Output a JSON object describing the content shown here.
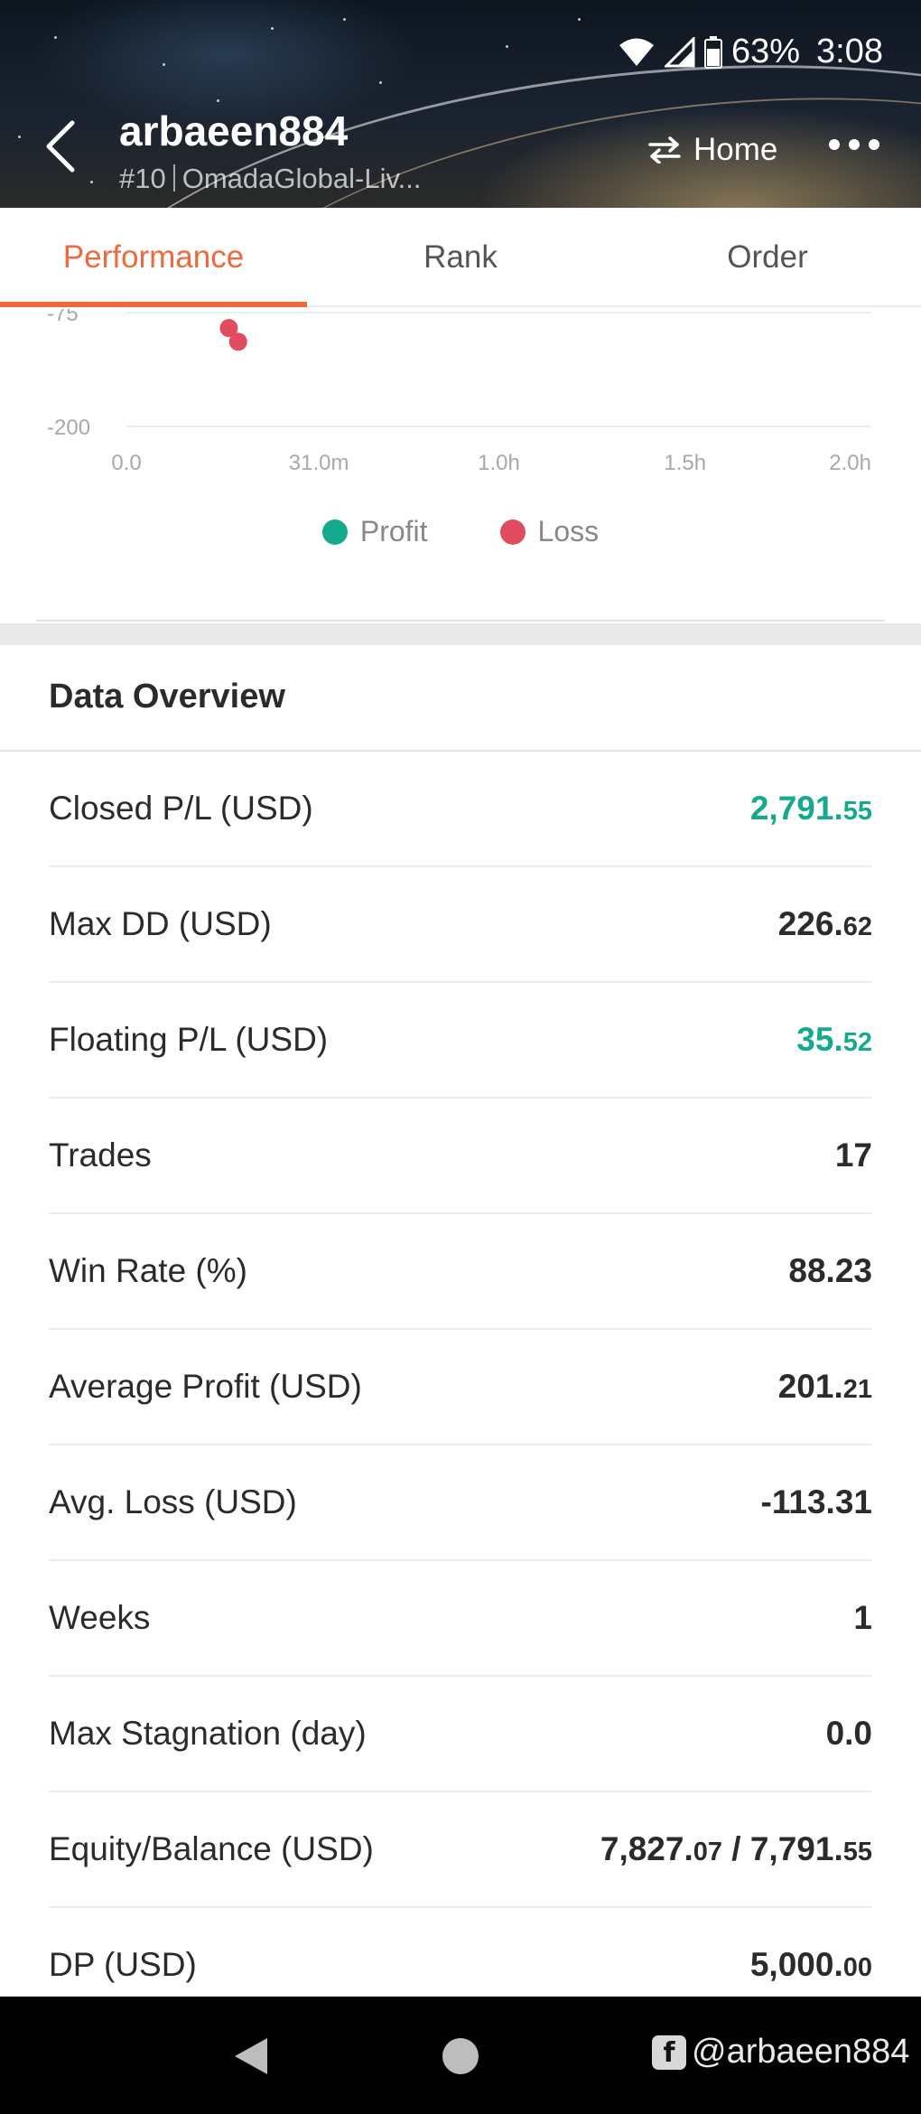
{
  "status_bar": {
    "battery": "63%",
    "time": "3:08"
  },
  "header": {
    "username": "arbaeen884",
    "rank": "#10",
    "account": "OmadaGlobal-Liv...",
    "home_label": "Home"
  },
  "tabs": [
    {
      "label": "Performance",
      "active": true
    },
    {
      "label": "Rank",
      "active": false
    },
    {
      "label": "Order",
      "active": false
    }
  ],
  "chart_data": {
    "type": "scatter",
    "y_ticks": [
      "-75",
      "-200"
    ],
    "x_ticks": [
      "0.0",
      "31.0m",
      "1.0h",
      "1.5h",
      "2.0h"
    ],
    "series": [
      {
        "name": "Profit",
        "color": "#15a98d",
        "points": []
      },
      {
        "name": "Loss",
        "color": "#e24c60",
        "points": [
          [
            16.5,
            -92
          ],
          [
            18,
            -107
          ]
        ]
      }
    ],
    "x_unit": "minutes",
    "xlim": [
      0,
      120
    ],
    "ylim": [
      -200,
      -75
    ],
    "grid": true,
    "legend_position": "bottom-center"
  },
  "overview": {
    "title": "Data Overview",
    "rows": [
      {
        "label": "Closed P/L (USD)",
        "int": "2,791.",
        "dec": "55",
        "color": "green"
      },
      {
        "label": "Max DD (USD)",
        "int": "226.",
        "dec": "62",
        "color": "dark"
      },
      {
        "label": "Floating P/L (USD)",
        "int": "35.",
        "dec": "52",
        "color": "green"
      },
      {
        "label": "Trades",
        "int": "17",
        "dec": "",
        "color": "dark"
      },
      {
        "label": "Win Rate (%)",
        "int": "88.23",
        "dec": "",
        "color": "dark"
      },
      {
        "label": "Average Profit (USD)",
        "int": "201.",
        "dec": "21",
        "color": "dark"
      },
      {
        "label": "Avg. Loss (USD)",
        "int": "-113.31",
        "dec": "",
        "color": "dark"
      },
      {
        "label": "Weeks",
        "int": "1",
        "dec": "",
        "color": "dark"
      },
      {
        "label": "Max Stagnation (day)",
        "int": "0.0",
        "dec": "",
        "color": "dark"
      },
      {
        "label": "Equity/Balance (USD)",
        "int": "7,827.",
        "dec": "07",
        "int2": " / 7,791.",
        "dec2": "55",
        "color": "dark"
      },
      {
        "label": "DP (USD)",
        "int": "5,000.",
        "dec": "00",
        "color": "dark"
      }
    ]
  },
  "watermark": {
    "icon": "f",
    "handle": "@arbaeen884"
  }
}
